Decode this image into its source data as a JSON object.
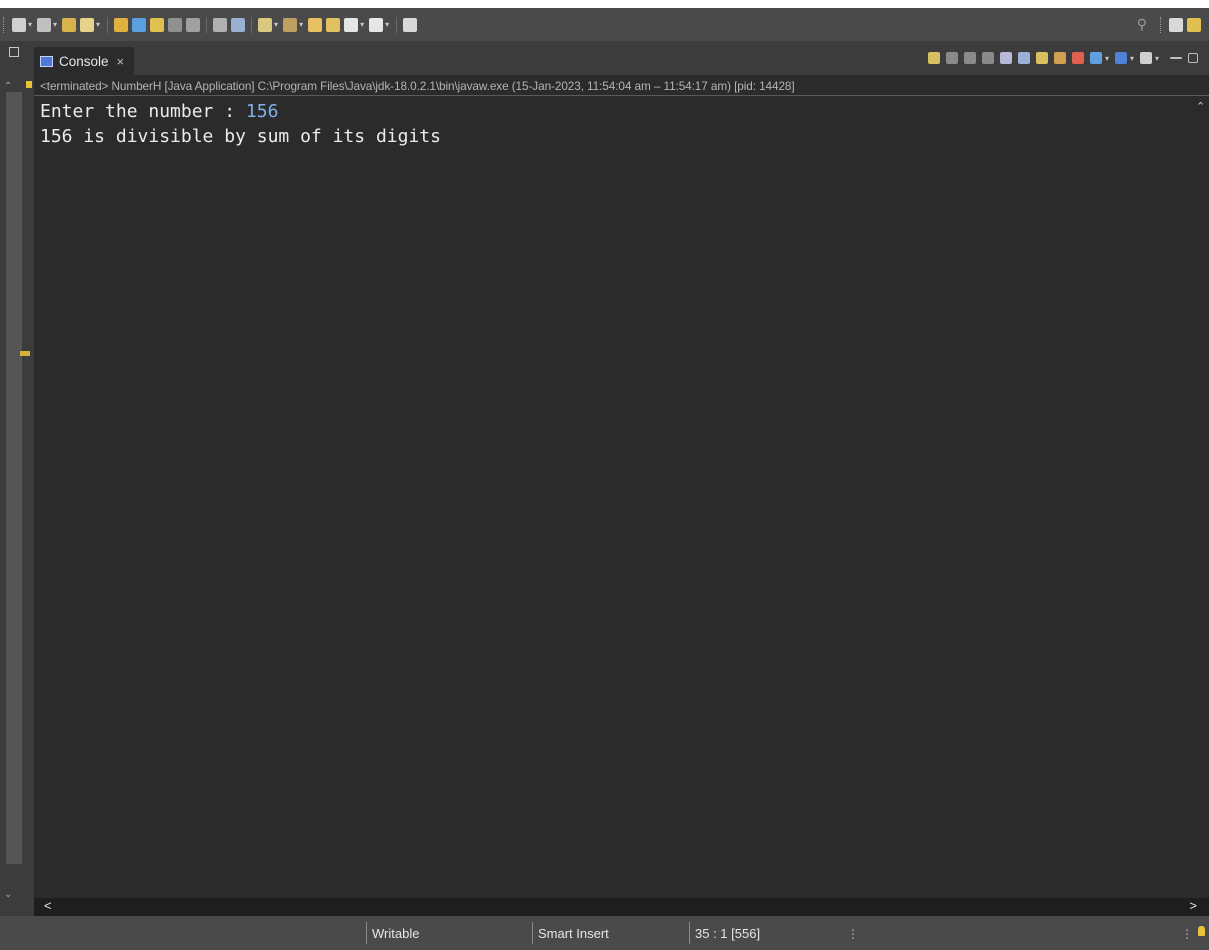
{
  "toolbar": {
    "icons": [
      {
        "name": "new-wizard-icon",
        "color": "#d0d0d0",
        "dropdown": true
      },
      {
        "name": "run-config-icon",
        "color": "#c0c0c0",
        "dropdown": true
      },
      {
        "name": "open-folder-icon",
        "color": "#d8b24a",
        "dropdown": false
      },
      {
        "name": "brush-icon",
        "color": "#e8d28a",
        "dropdown": true
      },
      {
        "name": "open-type-icon",
        "color": "#e0b040",
        "dropdown": false
      },
      {
        "name": "pencil-icon",
        "color": "#5aa0e0",
        "dropdown": false
      },
      {
        "name": "toggle-breadcrumb-icon",
        "color": "#e0c050",
        "dropdown": false
      },
      {
        "name": "block-selection-icon",
        "color": "#909090",
        "dropdown": false
      },
      {
        "name": "show-whitespace-icon",
        "color": "#a0a0a0",
        "dropdown": false
      },
      {
        "name": "debug-icon",
        "color": "#b0b0b0",
        "dropdown": false
      },
      {
        "name": "run-last-tool-icon",
        "color": "#9ab0d0",
        "dropdown": false
      },
      {
        "name": "next-annotation-icon",
        "color": "#d8c880",
        "dropdown": true
      },
      {
        "name": "prev-annotation-icon",
        "color": "#c0a060",
        "dropdown": true
      },
      {
        "name": "last-edit-icon",
        "color": "#e8c060",
        "dropdown": false
      },
      {
        "name": "pin-editor-icon",
        "color": "#e0c060",
        "dropdown": false
      },
      {
        "name": "back-icon",
        "color": "#e6e6e6",
        "dropdown": true
      },
      {
        "name": "forward-icon",
        "color": "#e6e6e6",
        "dropdown": true
      },
      {
        "name": "terminal-icon",
        "color": "#d8d8d8",
        "dropdown": false
      }
    ],
    "right_icons": [
      {
        "name": "perspective-icon",
        "color": "#d8d8d8"
      },
      {
        "name": "java-perspective-icon",
        "color": "#e0c050"
      }
    ]
  },
  "tab": {
    "label": "Console",
    "close": "×"
  },
  "view_tools": [
    {
      "name": "pin-console-icon",
      "color": "#d8c060"
    },
    {
      "name": "terminate-icon",
      "color": "#8a8a8a"
    },
    {
      "name": "remove-launch-icon",
      "color": "#8a8a8a"
    },
    {
      "name": "remove-all-icon",
      "color": "#8a8a8a"
    },
    {
      "name": "scroll-lock-icon",
      "color": "#b8b8d8"
    },
    {
      "name": "word-wrap-icon",
      "color": "#9ab0d8"
    },
    {
      "name": "show-on-output-icon",
      "color": "#d8c060"
    },
    {
      "name": "show-on-error-icon",
      "color": "#d0a050"
    },
    {
      "name": "show-on-stderr-icon",
      "color": "#e06050"
    },
    {
      "name": "open-console-icon",
      "color": "#60a0e0"
    },
    {
      "name": "display-console-icon",
      "color": "#5080d8"
    },
    {
      "name": "new-console-icon",
      "color": "#d0d0d0"
    },
    {
      "name": "view-minimize-icon",
      "color": "#bfbfbf"
    },
    {
      "name": "view-maximize-icon",
      "color": "#bfbfbf"
    }
  ],
  "process_line": "<terminated> NumberH [Java Application] C:\\Program Files\\Java\\jdk-18.0.2.1\\bin\\javaw.exe  (15-Jan-2023, 11:54:04 am – 11:54:17 am) [pid: 14428]",
  "console": {
    "prompt": "Enter the number : ",
    "input": "156",
    "output": "156 is divisible by sum of its digits"
  },
  "status": {
    "mode": "Writable",
    "insert": "Smart Insert",
    "position": "35 : 1 [556]"
  }
}
